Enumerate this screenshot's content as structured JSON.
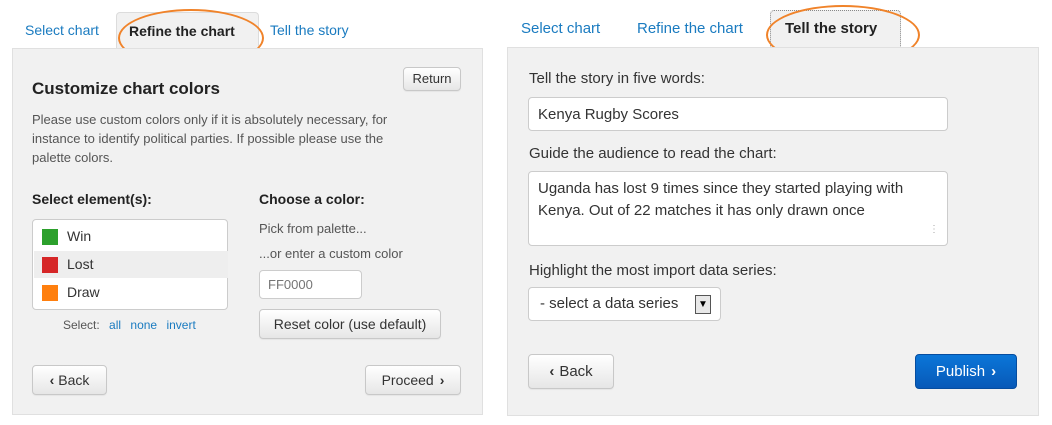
{
  "left": {
    "tabs": [
      "Select chart",
      "Refine the chart",
      "Tell the story"
    ],
    "heading": "Customize chart colors",
    "return_label": "Return",
    "description": [
      "Please use custom colors only if it is absolutely necessary, for",
      "instance to identify political parties. If possible please use the",
      "palette colors."
    ],
    "select_elements_heading": "Select element(s):",
    "elements": [
      {
        "label": "Win",
        "color": "#2ca02c"
      },
      {
        "label": "Lost",
        "color": "#d62728"
      },
      {
        "label": "Draw",
        "color": "#ff7f0e"
      }
    ],
    "select_label": "Select:",
    "select_all": "all",
    "select_none": "none",
    "select_invert": "invert",
    "choose_color_heading": "Choose a color:",
    "palette_text": "Pick from palette...",
    "custom_text": "...or enter a custom color",
    "color_placeholder": "FF0000",
    "reset_label": "Reset color (use default)",
    "back_label": "Back",
    "proceed_label": "Proceed"
  },
  "right": {
    "tabs": [
      "Select chart",
      "Refine the chart",
      "Tell the story"
    ],
    "story_label": "Tell the story in five words:",
    "story_value": "Kenya Rugby Scores",
    "guide_label": "Guide the audience to read the chart:",
    "guide_value": "Uganda has lost 9 times since they started playing with Kenya. Out of 22 matches it has only drawn once",
    "highlight_label": "Highlight the most import data series:",
    "select_value": "- select a data series",
    "back_label": "Back",
    "publish_label": "Publish"
  },
  "colors": {
    "accent": "#1a7bc0",
    "annotation": "#f0832a",
    "publish": "#0a68c8"
  }
}
